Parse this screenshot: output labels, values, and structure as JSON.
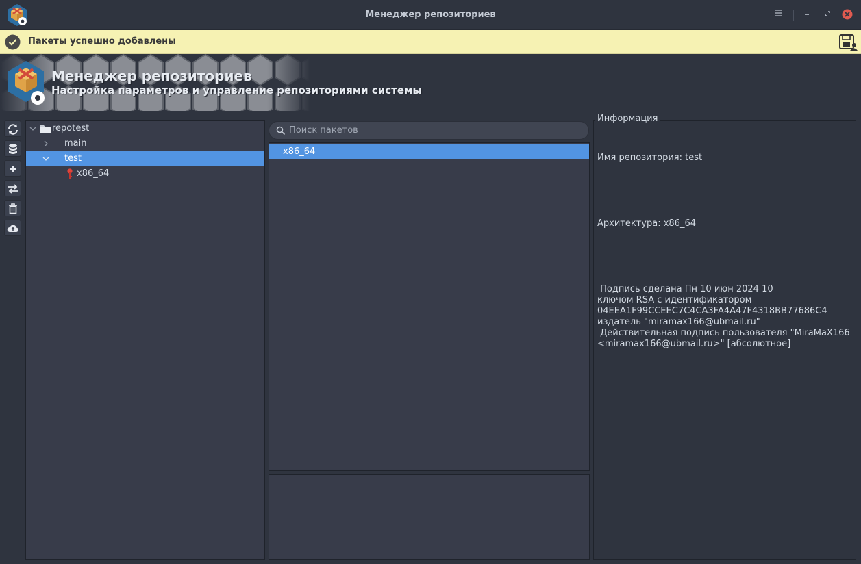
{
  "window": {
    "title": "Менеджер репозиториев",
    "menu_icon": "hamburger-menu-icon",
    "close_color": "#e05a50"
  },
  "notification": {
    "message": "Пакеты успешно добавлены",
    "background": "#f6f2b3"
  },
  "banner": {
    "title": "Менеджер репозиториев",
    "subtitle": "Настройка параметров и управление репозиториями системы"
  },
  "toolbar": {
    "items": [
      "refresh-icon",
      "database-icon",
      "plus-icon",
      "swap-icon",
      "trash-icon",
      "cloud-upload-icon"
    ]
  },
  "tree": {
    "root": "repotest",
    "items": [
      {
        "label": "main",
        "expanded": false,
        "selected": false
      },
      {
        "label": "test",
        "expanded": true,
        "selected": true
      },
      {
        "label": "x86_64",
        "icon": "key-icon",
        "selected": false
      }
    ]
  },
  "search": {
    "placeholder": "Поиск пакетов",
    "value": ""
  },
  "packages": {
    "items": [
      "x86_64"
    ]
  },
  "info": {
    "title": "Информация",
    "repo_name": "Имя репозитория: test",
    "architecture": "Архитектура: x86_64",
    "signature": " Подпись сделана Пн 10 июн 2024 10\nключом RSA с идентификатором\n04EEA1F99CCEEC7C4CA3FA4A47F4318BB77686C4\nиздатель \"miramax166@ubmail.ru\"\n Действительная подпись пользователя \"MiraMaX166\n<miramax166@ubmail.ru>\" [абсолютное]"
  },
  "colors": {
    "accent": "#5294e2",
    "background": "#2f343f",
    "panel": "#383c4a"
  }
}
